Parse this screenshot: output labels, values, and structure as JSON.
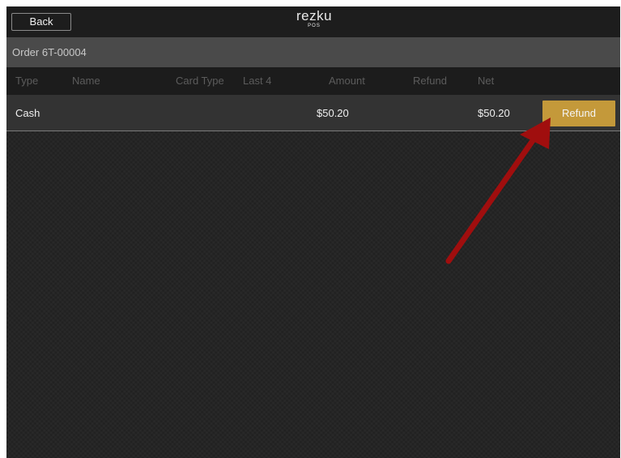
{
  "header": {
    "back_label": "Back",
    "logo_name": "rezku",
    "logo_sub": "POS"
  },
  "order": {
    "title": "Order 6T-00004"
  },
  "table": {
    "columns": [
      "Type",
      "Name",
      "Card Type",
      "Last 4",
      "Amount",
      "Refund",
      "Net"
    ],
    "rows": [
      {
        "type": "Cash",
        "name": "",
        "card_type": "",
        "last4": "",
        "amount": "$50.20",
        "refund": "",
        "net": "$50.20",
        "action_label": "Refund"
      }
    ]
  },
  "colors": {
    "accent": "#c4993a",
    "annotation_arrow": "#a00e0e"
  }
}
